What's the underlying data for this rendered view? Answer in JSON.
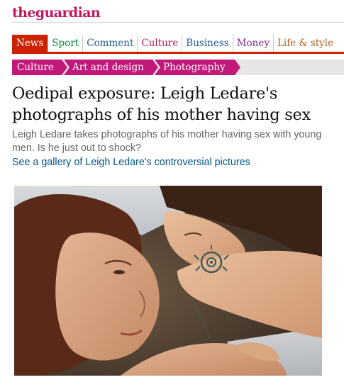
{
  "site": {
    "logo_prefix": "the",
    "logo_name": "guardian",
    "brand_color": "#c2185b"
  },
  "topnav": {
    "items": [
      {
        "label": "News",
        "color": "#ffffff",
        "active": true
      },
      {
        "label": "Sport",
        "color": "#008a3a"
      },
      {
        "label": "Comment",
        "color": "#1e5a8c"
      },
      {
        "label": "Culture",
        "color": "#c2185b"
      },
      {
        "label": "Business",
        "color": "#1e5a8c"
      },
      {
        "label": "Money",
        "color": "#7b2a8c"
      },
      {
        "label": "Life & style",
        "color": "#b06020"
      }
    ],
    "active_color": "#cc2200"
  },
  "breadcrumb": {
    "items": [
      {
        "label": "Culture"
      },
      {
        "label": "Art and design"
      },
      {
        "label": "Photography"
      }
    ],
    "color": "#c2187a"
  },
  "article": {
    "headline": "Oedipal exposure: Leigh Ledare's photographs of his mother having sex",
    "standfirst": "Leigh Ledare takes photographs of his mother having sex with young men. Is he just out to shock?",
    "gallery_link": "See a gallery of Leigh Ledare's controversial pictures",
    "link_color": "#005689"
  }
}
